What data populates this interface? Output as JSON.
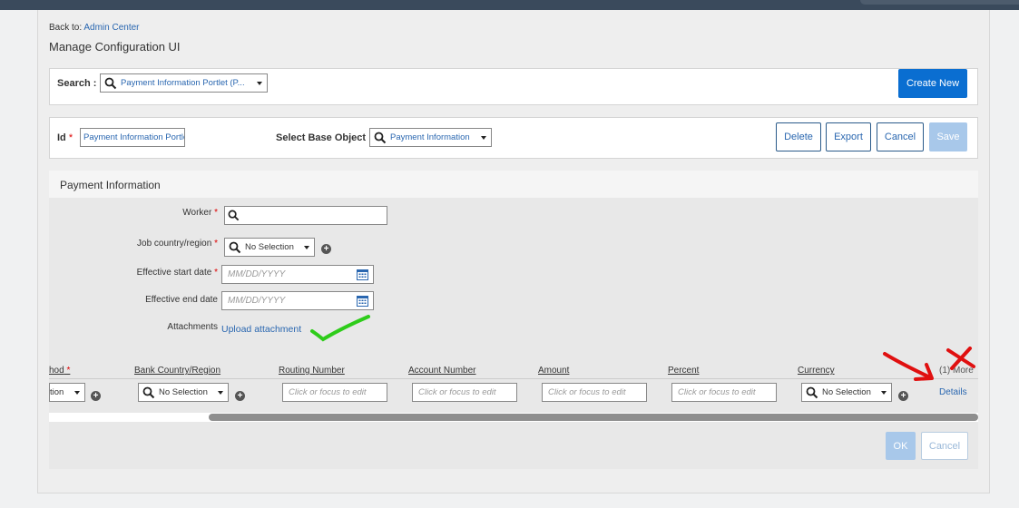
{
  "header": {
    "back_prefix": "Back to:",
    "back_link": "Admin Center",
    "title": "Manage Configuration UI"
  },
  "search": {
    "label": "Search :",
    "value": "Payment Information Portlet (P...",
    "create_new": "Create New"
  },
  "id_row": {
    "id_label": "Id",
    "id_value": "Payment Information Portlet",
    "base_object_label": "Select Base Object",
    "base_object_value": "Payment Information",
    "buttons": {
      "delete": "Delete",
      "export": "Export",
      "cancel": "Cancel",
      "save": "Save"
    }
  },
  "section": {
    "title": "Payment Information"
  },
  "form": {
    "worker_label": "Worker",
    "country_label": "Job country/region",
    "country_value": "No Selection",
    "start_label": "Effective start date",
    "start_placeholder": "MM/DD/YYYY",
    "end_label": "Effective end date",
    "end_placeholder": "MM/DD/YYYY",
    "attachments_label": "Attachments",
    "upload_link": "Upload attachment"
  },
  "grid": {
    "columns": [
      "hod",
      "Bank Country/Region",
      "Routing Number",
      "Account Number",
      "Amount",
      "Percent",
      "Currency",
      "(1) More"
    ],
    "row": {
      "method_value": "tion",
      "bank_country": "No Selection",
      "routing_placeholder": "Click or focus to edit",
      "account_placeholder": "Click or focus to edit",
      "amount_placeholder": "Click or focus to edit",
      "percent_placeholder": "Click or focus to edit",
      "currency": "No Selection",
      "details": "Details"
    }
  },
  "footer": {
    "ok": "OK",
    "cancel": "Cancel"
  },
  "colors": {
    "primary": "#0a6ed1",
    "link": "#2a67b0",
    "required": "#d00000",
    "annotation_green": "#2ecc1a",
    "annotation_red": "#e01010"
  }
}
